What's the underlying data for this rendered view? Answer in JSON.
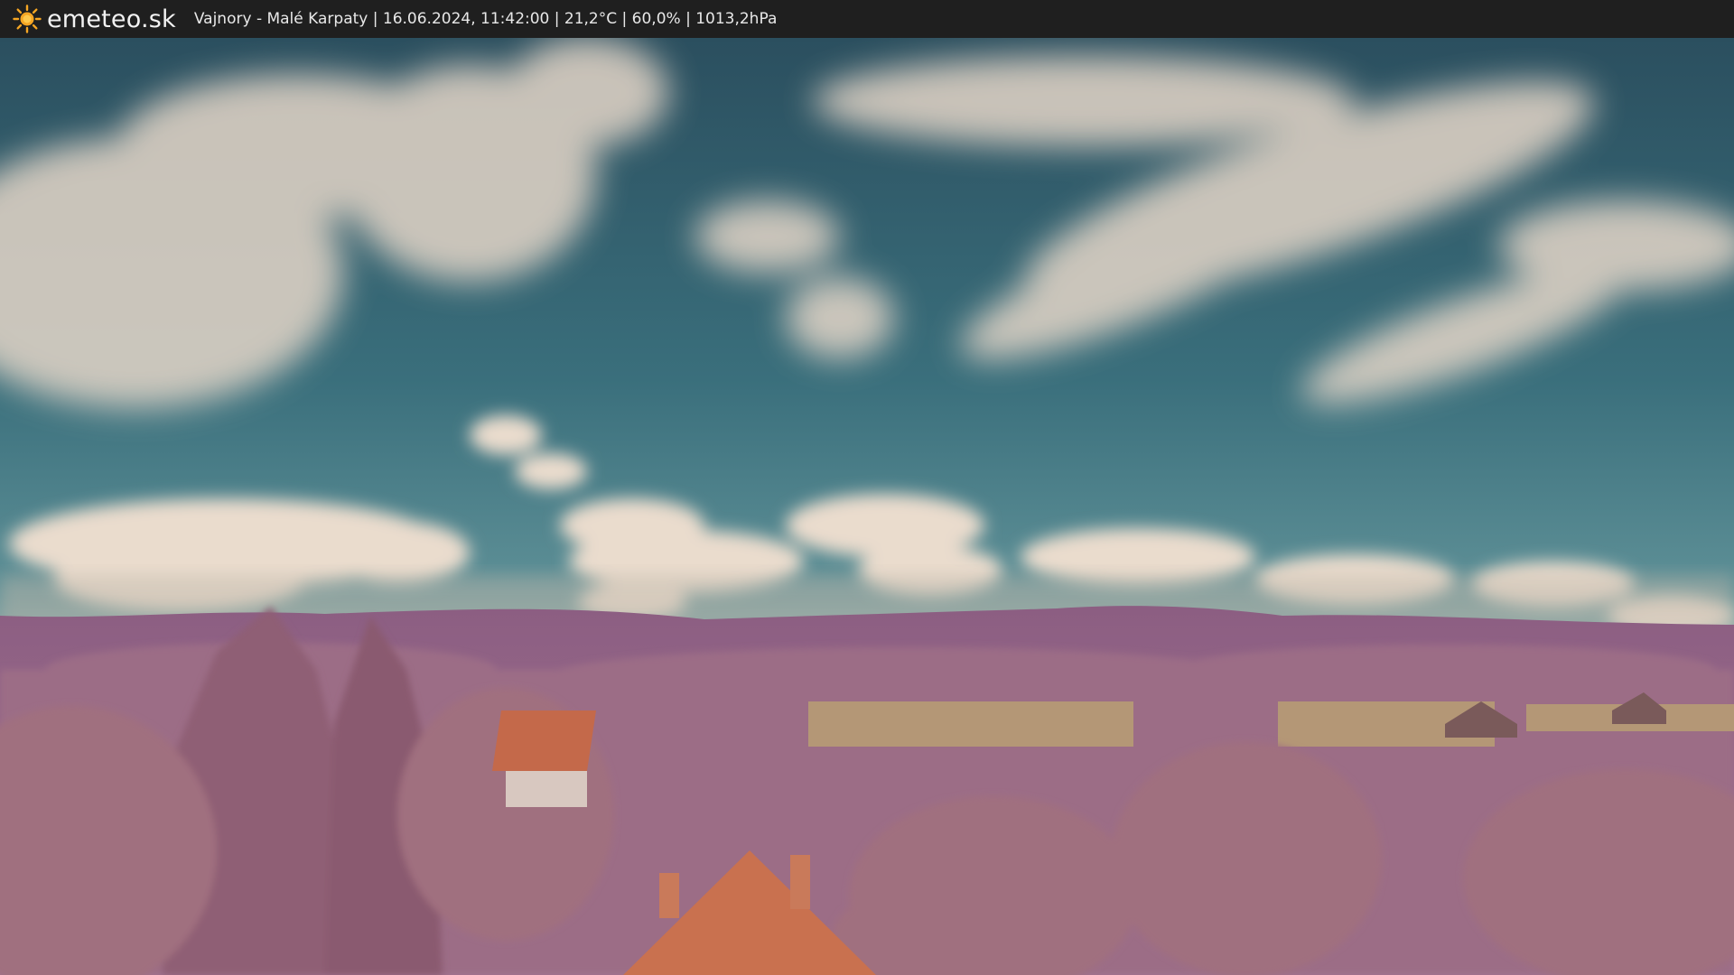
{
  "header": {
    "brand": "emeteo.sk",
    "caption": "Vajnory - Malé Karpaty | 16.06.2024, 11:42:00 | 21,2°C | 60,0% | 1013,2hPa",
    "logo_icon": "sun-icon"
  },
  "colors": {
    "topbar": "#1f1f1f",
    "sun": "#f6a623",
    "sky_top": "#2e5566",
    "sky_horizon": "#5a8c97",
    "clouds": "#e6d8c8",
    "hills": "#8a5e80",
    "trees": "#a0707f",
    "roof": "#c06a4b",
    "field": "#b39676"
  }
}
